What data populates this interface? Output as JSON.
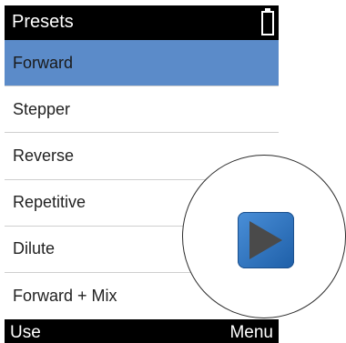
{
  "header": {
    "title": "Presets"
  },
  "presets": [
    {
      "label": "Forward",
      "selected": true
    },
    {
      "label": "Stepper",
      "selected": false
    },
    {
      "label": "Reverse",
      "selected": false
    },
    {
      "label": "Repetitive",
      "selected": false
    },
    {
      "label": "Dilute",
      "selected": false
    },
    {
      "label": "Forward + Mix",
      "selected": false
    }
  ],
  "softkeys": {
    "left": "Use",
    "right": "Menu"
  },
  "icons": {
    "status": "battery-icon",
    "callout": "play-icon"
  },
  "colors": {
    "selection": "#5b8bc9",
    "play_button": "#2f76c6"
  }
}
